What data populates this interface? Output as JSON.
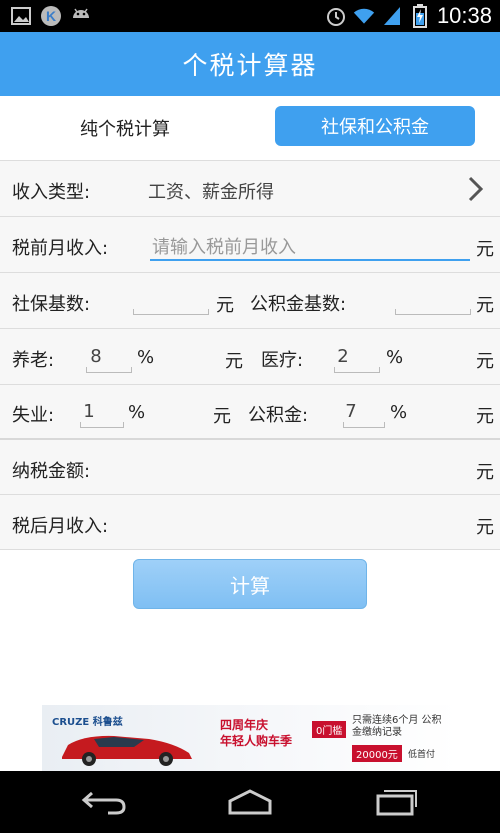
{
  "status_bar": {
    "time": "10:38",
    "left_icons": [
      "image-icon",
      "k-app-icon",
      "android-icon"
    ],
    "right_icons": [
      "alarm-icon",
      "wifi-icon",
      "signal-icon",
      "battery-icon"
    ]
  },
  "app_bar": {
    "title": "个税计算器"
  },
  "tabs": {
    "left_label": "纯个税计算",
    "right_label": "社保和公积金"
  },
  "form": {
    "income_type_label": "收入类型:",
    "income_type_value": "工资、薪金所得",
    "pretax_label": "税前月收入:",
    "pretax_placeholder": "请输入税前月收入",
    "unit_yuan": "元",
    "social_base_label": "社保基数:",
    "fund_base_label": "公积金基数:",
    "pension_label": "养老:",
    "pension_value": "8",
    "medical_label": "医疗:",
    "medical_value": "2",
    "unemployment_label": "失业:",
    "unemployment_value": "1",
    "fund_label": "公积金:",
    "fund_value": "7",
    "percent": "%",
    "tax_amount_label": "纳税金额:",
    "after_tax_label": "税后月收入:"
  },
  "calculate_button": "计算",
  "ad": {
    "brand": "CRUZE 科鲁兹",
    "promo_line": "四周年庆",
    "promo_sub": "年轻人购车季",
    "badge": "0门槛",
    "text": "只需连续6个月 公积金缴纳记录",
    "price": "20000元",
    "price_note": "低首付"
  },
  "colors": {
    "accent": "#3fa0ef",
    "row_bg": "#f7f7f7",
    "divider": "#dddddd"
  }
}
